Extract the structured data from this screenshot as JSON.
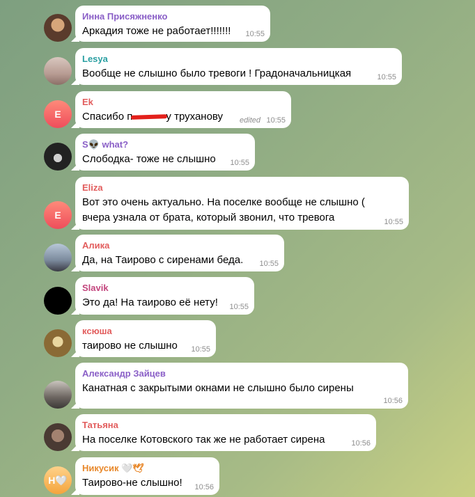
{
  "colors": {
    "name_purple": "#8a5fc7",
    "name_teal": "#2a9fa2",
    "name_red": "#e25d5d",
    "name_pink": "#c3457d",
    "name_orange": "#e8882b",
    "time": "#8e8e8e"
  },
  "messages": [
    {
      "name": "Инна Присяжненко",
      "text": "Аркадия тоже не работает!!!!!!!",
      "time": "10:55"
    },
    {
      "name": "Lesya",
      "text": "Вообще не слышно было тревоги ! Градоначальницкая",
      "time": "10:55"
    },
    {
      "name": "Ek",
      "avatar_initial": "E",
      "text_before": "Спасибо п",
      "text_after": "у труханову",
      "edited": "edited",
      "time": "10:55"
    },
    {
      "name": "S👽 what?",
      "text": "Слободка- тоже не слышно",
      "time": "10:55"
    },
    {
      "name": "Eliza",
      "avatar_initial": "E",
      "text_line1": "Вот это очень актуально. На поселке вообще не слышно (",
      "text_line2": "вчера узнала от брата, который звонил, что тревога",
      "time": "10:55"
    },
    {
      "name": "Алика",
      "text": "Да, на Таирово с сиренами беда.",
      "time": "10:55"
    },
    {
      "name": "Slavik",
      "text": "Это да! На таирово её нету!",
      "time": "10:55"
    },
    {
      "name": "ксюша",
      "text": "таирово не слышно",
      "time": "10:55"
    },
    {
      "name": "Александр Зайцев",
      "text": "Канатная с закрытыми окнами не слышно было сирены",
      "time": "10:56"
    },
    {
      "name": "Татьяна",
      "text": "На поселке Котовского так же не работает сирена",
      "time": "10:56"
    },
    {
      "name": "Никусик 🤍🕊",
      "avatar_initial": "Н🤍",
      "text": "Таирово-не слышно!",
      "time": "10:56"
    }
  ]
}
